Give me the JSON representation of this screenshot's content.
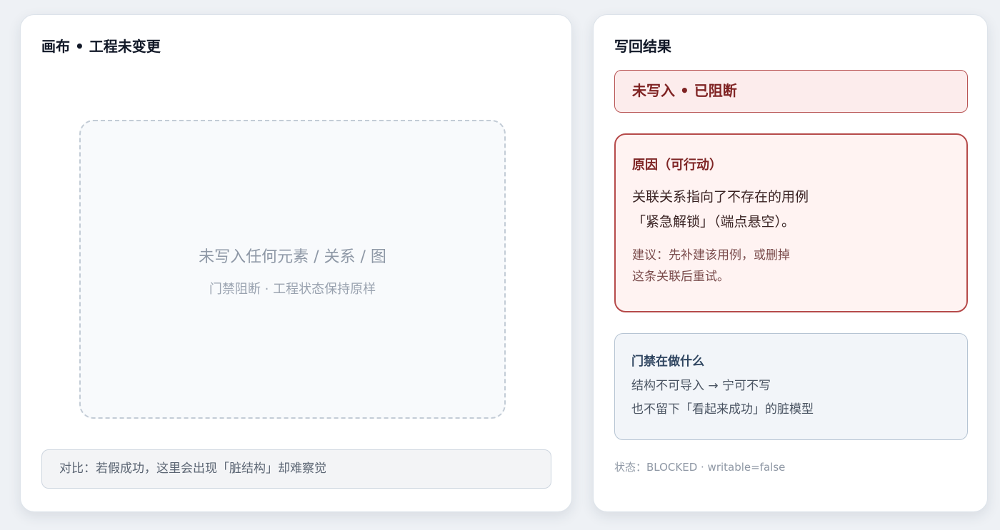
{
  "canvas": {
    "title": "画布 • 工程未变更",
    "empty_title": "未写入任何元素 / 关系 / 图",
    "empty_subtitle": "门禁阻断 · 工程状态保持原样",
    "compare_note": "对比：若假成功，这里会出现「脏结构」却难察觉"
  },
  "result": {
    "title": "写回结果",
    "status": "未写入 • 已阻断",
    "reason": {
      "title": "原因（可行动）",
      "lines": [
        "关联关系指向了不存在的用例",
        "「紧急解锁」（端点悬空）。"
      ],
      "hint_lines": [
        "建议：先补建该用例，或删掉",
        "这条关联后重试。"
      ]
    },
    "gate": {
      "title": "门禁在做什么",
      "lines": [
        "结构不可导入 → 宁可不写",
        "也不留下「看起来成功」的脏模型"
      ]
    },
    "state_line": "状态：BLOCKED · writable=false"
  }
}
